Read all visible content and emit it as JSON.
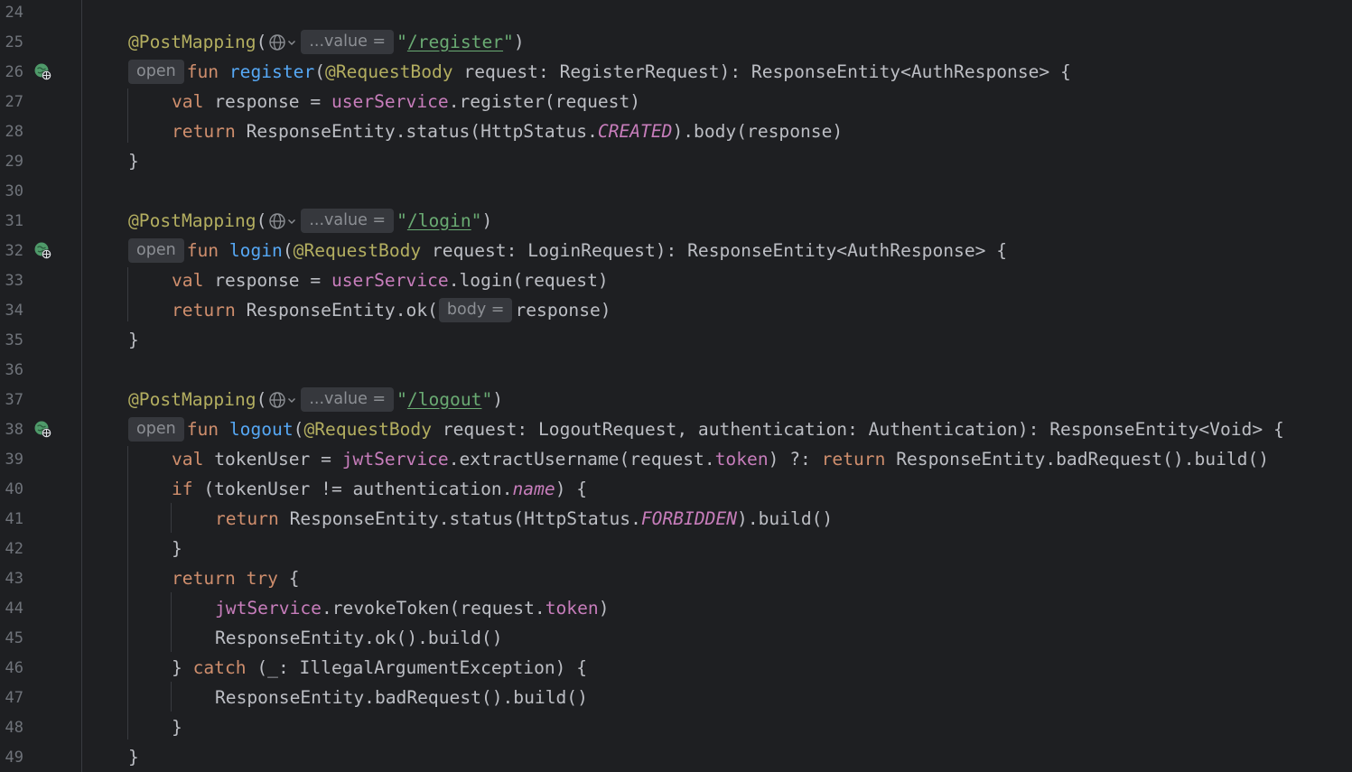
{
  "editor": {
    "hints": {
      "value": "...value =",
      "open": "open",
      "body": "body ="
    },
    "lines": [
      {
        "num": "24"
      },
      {
        "num": "25",
        "path": "/register"
      },
      {
        "num": "26",
        "func": "register",
        "param_type": "RegisterRequest",
        "ret": "ResponseEntity<AuthResponse> {"
      },
      {
        "num": "27",
        "call": ".register(request)"
      },
      {
        "num": "28",
        "pre": "ResponseEntity.status(HttpStatus.",
        "const": "CREATED",
        "post": ").body(response)"
      },
      {
        "num": "29",
        "brace": "}"
      },
      {
        "num": "30"
      },
      {
        "num": "31",
        "path": "/login"
      },
      {
        "num": "32",
        "func": "login",
        "param_type": "LoginRequest",
        "ret": "ResponseEntity<AuthResponse> {"
      },
      {
        "num": "33",
        "call": ".login(request)"
      },
      {
        "num": "34",
        "pre": "ResponseEntity.ok(",
        "post": "response)"
      },
      {
        "num": "35",
        "brace": "}"
      },
      {
        "num": "36"
      },
      {
        "num": "37",
        "path": "/logout"
      },
      {
        "num": "38",
        "func": "logout",
        "param_type": "LogoutRequest, authentication: Authentication",
        "ret": "ResponseEntity<Void> {"
      },
      {
        "num": "39",
        "var": "tokenUser",
        "call": ".extractUsername(request.",
        "prop": "token",
        "mid": ") ?: ",
        "tail": "ResponseEntity.badRequest().build()"
      },
      {
        "num": "40",
        "pre": "(tokenUser != authentication.",
        "prop": "name",
        "post": ") {"
      },
      {
        "num": "41",
        "pre": "ResponseEntity.status(HttpStatus.",
        "const": "FORBIDDEN",
        "post": ").build()"
      },
      {
        "num": "42",
        "brace": "}"
      },
      {
        "num": "43",
        "post": "{"
      },
      {
        "num": "44",
        "call": ".revokeToken(request.",
        "prop": "token",
        "post": ")"
      },
      {
        "num": "45",
        "text": "ResponseEntity.ok().build()"
      },
      {
        "num": "46",
        "pre": "(_: IllegalArgumentException) {"
      },
      {
        "num": "47",
        "text": "ResponseEntity.badRequest().build()"
      },
      {
        "num": "48",
        "brace": "}"
      },
      {
        "num": "49",
        "brace": "}"
      }
    ],
    "tokens": {
      "annotation": "@PostMapping",
      "request_body": "@RequestBody",
      "kw_fun": "fun",
      "kw_val": "val",
      "kw_return": "return",
      "kw_if": "if",
      "kw_try": "try",
      "kw_catch": "catch",
      "var_response": "response",
      "var_request": "request",
      "user_service": "userService",
      "jwt_service": "jwtService"
    }
  }
}
